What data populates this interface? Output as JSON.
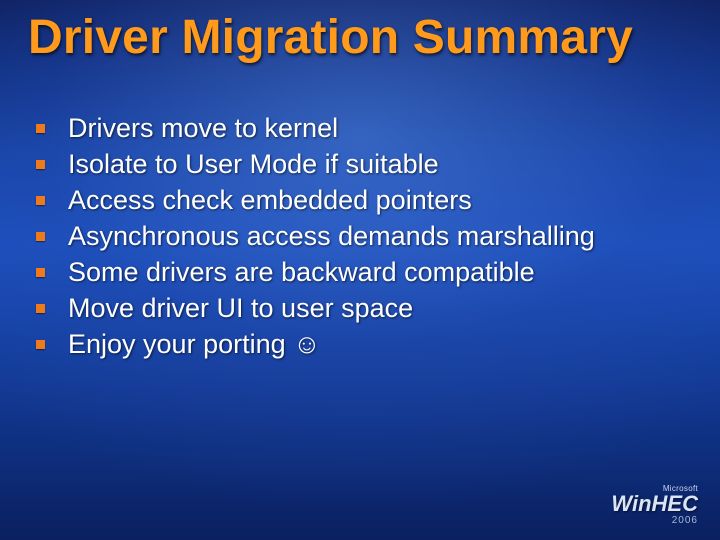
{
  "title": "Driver Migration Summary",
  "bullets": [
    "Drivers move to kernel",
    "Isolate to User Mode if suitable",
    "Access check embedded pointers",
    "Asynchronous access demands marshalling",
    "Some drivers are backward compatible",
    "Move driver UI to user space",
    "Enjoy your porting ☺"
  ],
  "logo": {
    "company": "Microsoft",
    "brand": "WinHEC",
    "year": "2006"
  }
}
